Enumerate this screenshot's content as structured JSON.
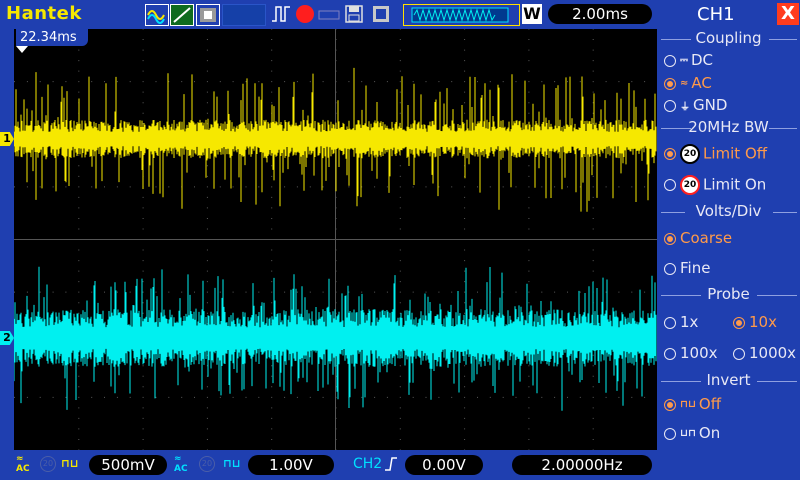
{
  "brand": "Hantek",
  "timebase": "2.00ms",
  "trigger_time": "22.34ms",
  "toolbar": {
    "w_badge": "W"
  },
  "channel_markers": {
    "ch1": "1",
    "ch2": "2"
  },
  "bottom": {
    "ch1_scale": "500mV",
    "ch2_scale": "1.00V",
    "trigger_source": "CH2",
    "trigger_level": "0.00V",
    "frequency": "2.00000Hz",
    "coupling_ac": "AC"
  },
  "panel": {
    "title": "CH1",
    "close": "X",
    "coupling": {
      "title": "Coupling",
      "options": [
        "DC",
        "AC",
        "GND"
      ],
      "selected": "AC"
    },
    "bandwidth": {
      "title": "20MHz BW",
      "options": [
        "Limit Off",
        "Limit On"
      ],
      "selected": "Limit Off",
      "icon_text": "20"
    },
    "volts_div": {
      "title": "Volts/Div",
      "options": [
        "Coarse",
        "Fine"
      ],
      "selected": "Coarse"
    },
    "probe": {
      "title": "Probe",
      "options": [
        "1x",
        "10x",
        "100x",
        "1000x"
      ],
      "selected": "10x"
    },
    "invert": {
      "title": "Invert",
      "options": [
        "Off",
        "On"
      ],
      "selected": "Off"
    }
  },
  "colors": {
    "ch1": "#f6e800",
    "ch2": "#00f0f0",
    "background": "#1f3fb0",
    "accent": "#ff9a4a"
  }
}
